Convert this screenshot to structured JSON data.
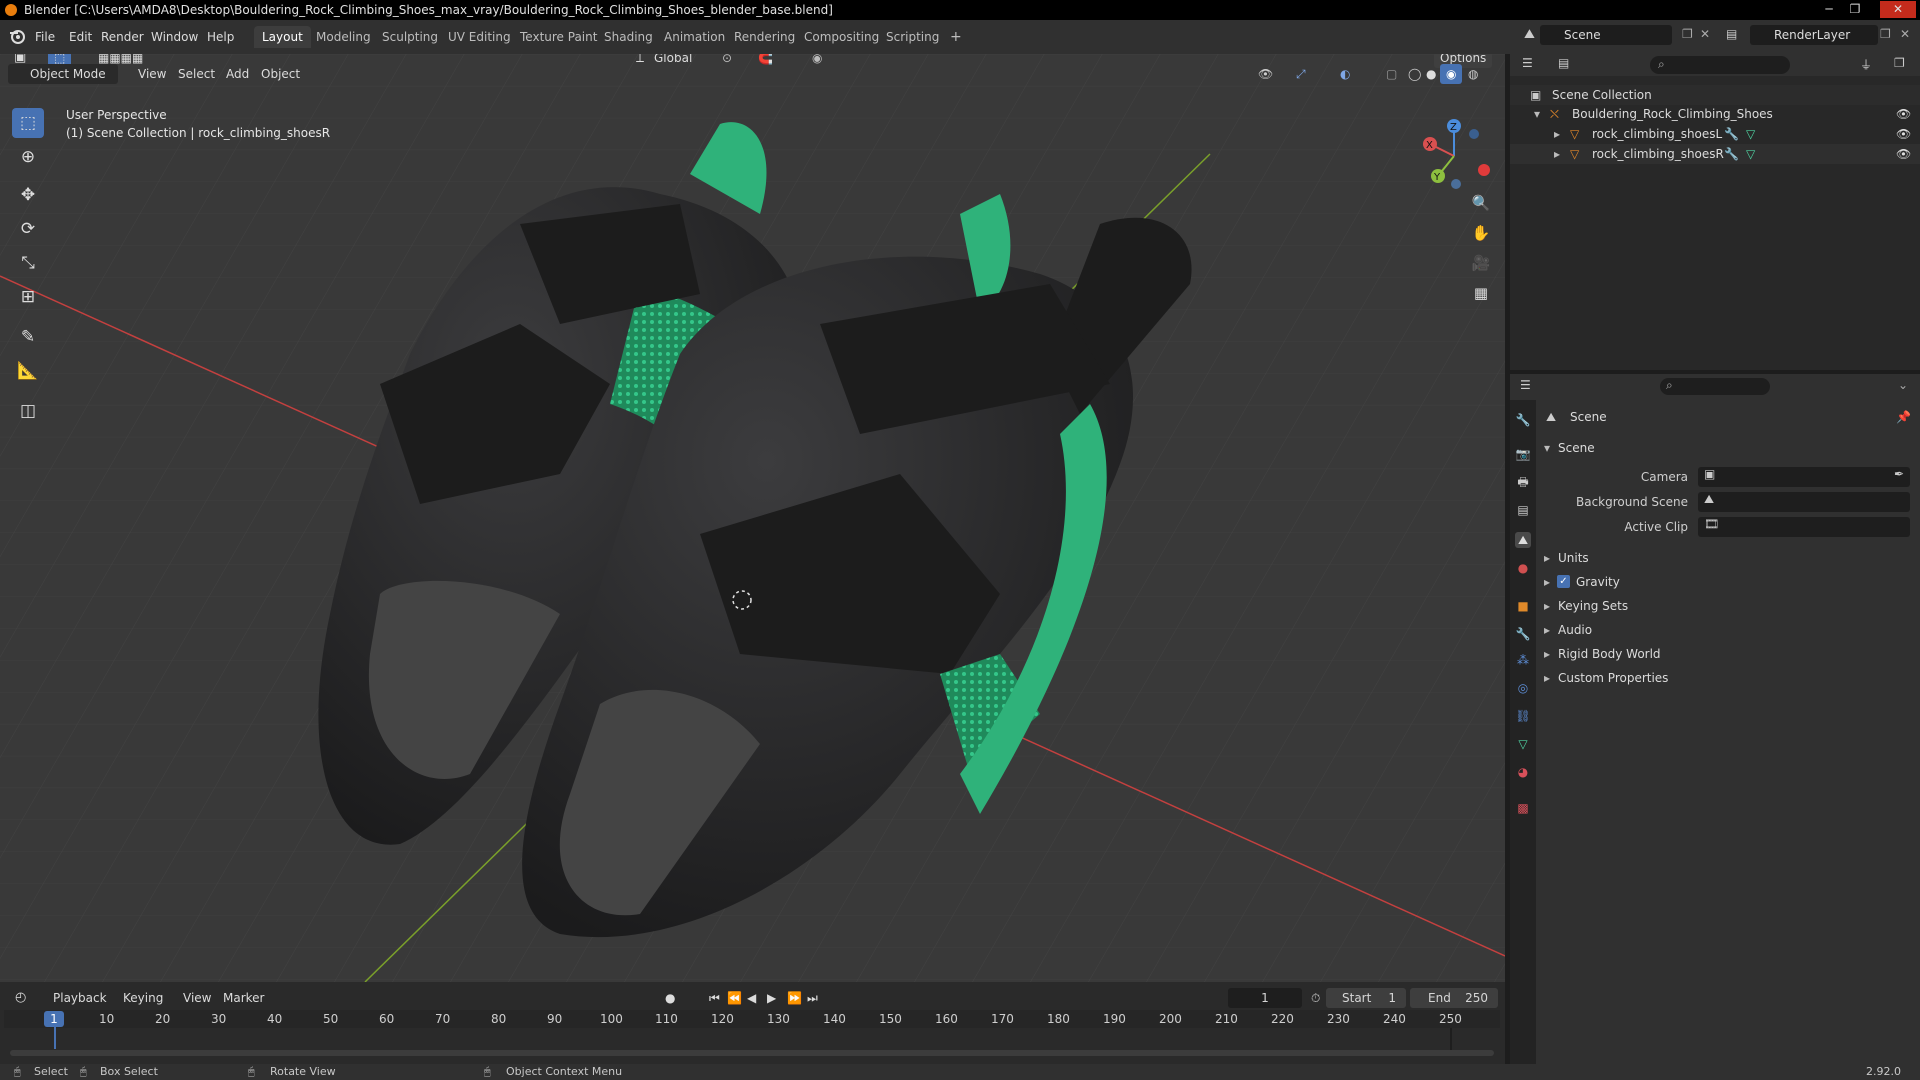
{
  "window": {
    "title": "Blender [C:\\Users\\AMDA8\\Desktop\\Bouldering_Rock_Climbing_Shoes_max_vray/Bouldering_Rock_Climbing_Shoes_blender_base.blend]",
    "minimize": "─",
    "maximize": "❐",
    "close": "✕"
  },
  "menus": [
    "File",
    "Edit",
    "Render",
    "Window",
    "Help"
  ],
  "workspaces": [
    "Layout",
    "Modeling",
    "Sculpting",
    "UV Editing",
    "Texture Paint",
    "Shading",
    "Animation",
    "Rendering",
    "Compositing",
    "Scripting",
    "+"
  ],
  "scene_field": "Scene",
  "renderlayer_field": "RenderLayer",
  "viewport": {
    "transform_orientation": "Global",
    "options_label": "Options",
    "mode": "Object Mode",
    "menus": [
      "View",
      "Select",
      "Add",
      "Object"
    ],
    "overlay_line1": "User Perspective",
    "overlay_line2": "(1) Scene Collection | rock_climbing_shoesR",
    "gizmo": {
      "x": "X",
      "y": "Y",
      "z": "Z"
    }
  },
  "outliner": {
    "root": "Scene Collection",
    "collection": "Bouldering_Rock_Climbing_Shoes",
    "objects": [
      "rock_climbing_shoesL",
      "rock_climbing_shoesR"
    ]
  },
  "properties": {
    "context": "Scene",
    "panel": "Scene",
    "camera_label": "Camera",
    "background_label": "Background Scene",
    "clip_label": "Active Clip",
    "sections": [
      "Units",
      "Gravity",
      "Keying Sets",
      "Audio",
      "Rigid Body World",
      "Custom Properties"
    ],
    "gravity_checked": true
  },
  "timeline": {
    "menus": [
      "Playback",
      "Keying",
      "View",
      "Marker"
    ],
    "current_frame": "1",
    "start_label": "Start",
    "start": "1",
    "end_label": "End",
    "end": "250",
    "ticks": [
      "1",
      "10",
      "20",
      "30",
      "40",
      "50",
      "60",
      "70",
      "80",
      "90",
      "100",
      "110",
      "120",
      "130",
      "140",
      "150",
      "160",
      "170",
      "180",
      "190",
      "200",
      "210",
      "220",
      "230",
      "240",
      "250"
    ]
  },
  "status": {
    "select": "Select",
    "box_select": "Box Select",
    "rotate": "Rotate View",
    "context_menu": "Object Context Menu",
    "version": "2.92.0"
  },
  "colors": {
    "accent": "#4772b3",
    "green_trim": "#2fb27a",
    "shoe_body": "#2b2b2c",
    "x_axis": "#c3403f",
    "y_axis": "#7aa02a"
  }
}
